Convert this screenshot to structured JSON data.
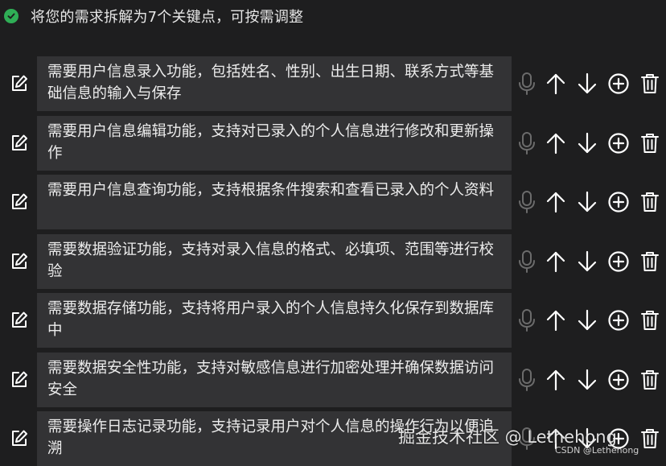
{
  "header": {
    "title": "将您的需求拆解为7个关键点，可按需调整"
  },
  "items": [
    {
      "text": "需要用户信息录入功能，包括姓名、性别、出生日期、联系方式等基础信息的输入与保存"
    },
    {
      "text": "需要用户信息编辑功能，支持对已录入的个人信息进行修改和更新操作"
    },
    {
      "text": "需要用户信息查询功能，支持根据条件搜索和查看已录入的个人资料"
    },
    {
      "text": "需要数据验证功能，支持对录入信息的格式、必填项、范围等进行校验"
    },
    {
      "text": "需要数据存储功能，支持将用户录入的个人信息持久化保存到数据库中"
    },
    {
      "text": "需要数据安全性功能，支持对敏感信息进行加密处理并确保数据访问安全"
    },
    {
      "text": "需要操作日志记录功能，支持记录用户对个人信息的操作行为以便追溯"
    }
  ],
  "icons": {
    "status": "check-circle-icon",
    "edit": "edit-icon",
    "mic": "microphone-icon",
    "up": "arrow-up-icon",
    "down": "arrow-down-icon",
    "add": "plus-circle-icon",
    "delete": "trash-icon"
  },
  "colors": {
    "background": "#1e1e1f",
    "text_box": "#333335",
    "check": "#2fae56",
    "mic_disabled": "#6b6b6b",
    "icon": "#ffffff"
  },
  "watermark": {
    "main": "掘金技术社区 @ Lethehong",
    "sub": "CSDN @Lethehong"
  }
}
